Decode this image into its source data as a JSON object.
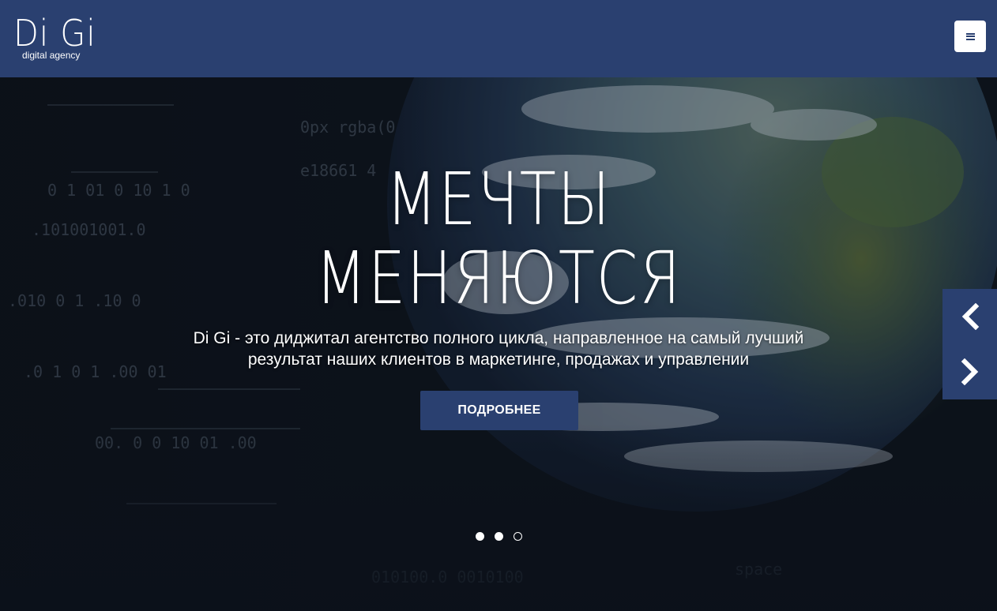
{
  "header": {
    "logo_title": "Di Gi",
    "logo_subtitle": "digital agency",
    "menu_icon": "hamburger-menu-icon",
    "brand_color": "#2a4070"
  },
  "hero": {
    "headline_line1": "МЕЧТЫ",
    "headline_line2": "МЕНЯЮТСЯ",
    "subtitle_line1": "Di Gi - это диджитал агентство полного цикла, направленное на самый лучший",
    "subtitle_line2": "результат наших клиентов в маркетинге, продажах и управлении",
    "cta_label": "ПОДРОБНЕЕ",
    "prev_icon": "chevron-left-icon",
    "next_icon": "chevron-right-icon",
    "slides_total": 3,
    "background_image": "earth-with-digital-code"
  }
}
